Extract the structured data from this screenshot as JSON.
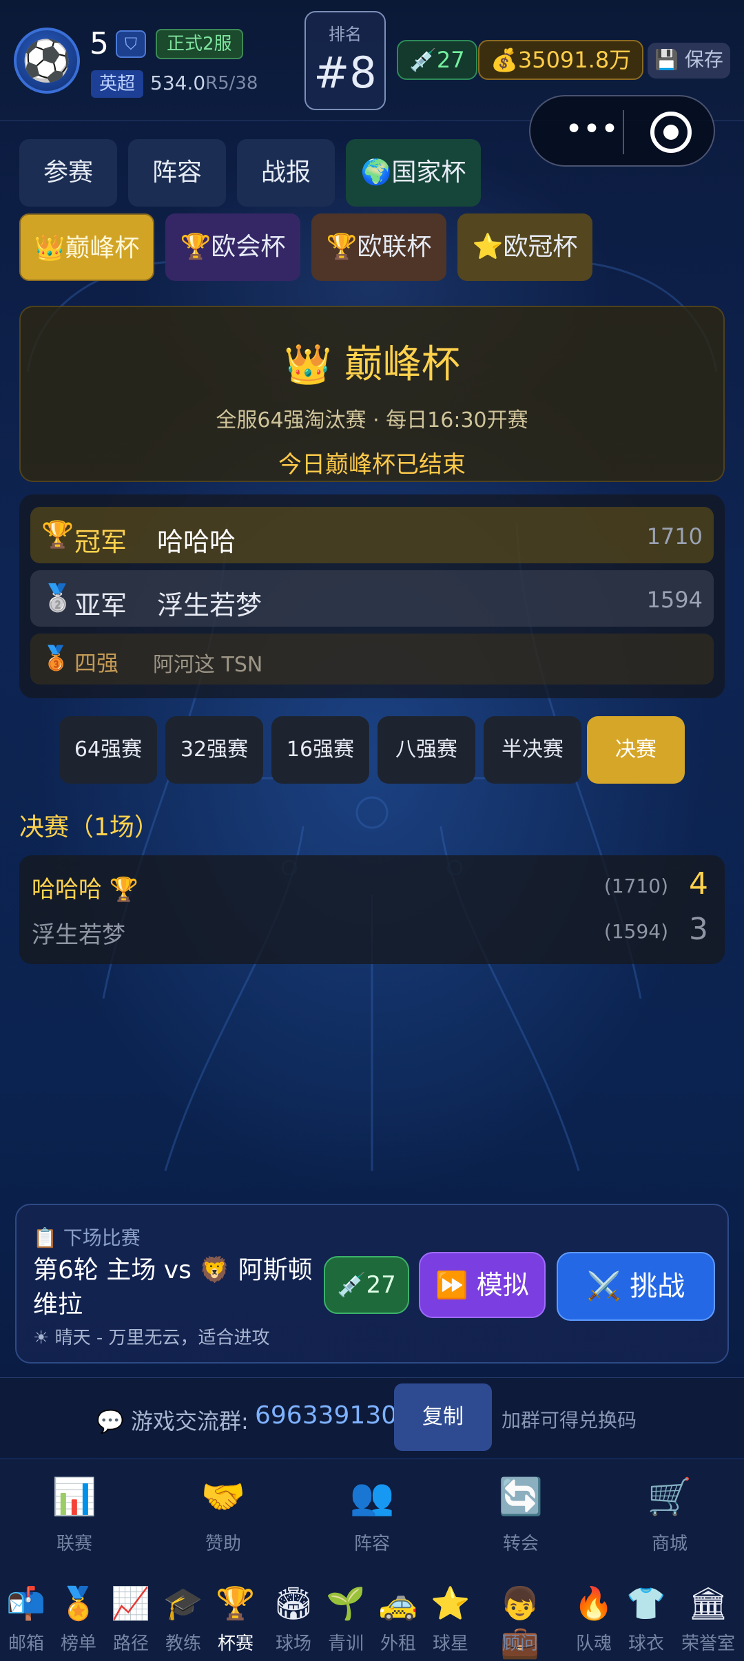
{
  "topbar": {
    "level": "5",
    "server": "正式2服",
    "league": "英超",
    "points": "534.0",
    "round": "R5/38",
    "rank_label": "排名",
    "rank_value": "#8",
    "energy": "27",
    "gold": "35091.8万",
    "save_label": "保存"
  },
  "capsule": {
    "menu": "•••"
  },
  "tabs_row1": [
    {
      "label": "参赛"
    },
    {
      "label": "阵容"
    },
    {
      "label": "战报"
    },
    {
      "label": "🌍国家杯"
    }
  ],
  "tabs_row2": [
    {
      "label": "👑巅峰杯"
    },
    {
      "label": "🏆欧会杯"
    },
    {
      "label": "🏆欧联杯"
    },
    {
      "label": "⭐欧冠杯"
    }
  ],
  "hero": {
    "title": "👑 巅峰杯",
    "subtitle": "全服64强淘汰赛 · 每日16:30开赛",
    "status": "今日巅峰杯已结束"
  },
  "results": {
    "champion": {
      "icon": "🏆",
      "rank": "冠军",
      "name": "哈哈哈",
      "score": "1710"
    },
    "runner_up": {
      "icon": "🥈",
      "rank": "亚军",
      "name": "浮生若梦",
      "score": "1594"
    },
    "semis": {
      "icon": "🥉",
      "rank": "四强",
      "names": "阿河这  TSN"
    }
  },
  "stages": [
    "64强赛",
    "32强赛",
    "16强赛",
    "八强赛",
    "半决赛",
    "决赛"
  ],
  "section_title": "决赛（1场）",
  "match": {
    "team1": "哈哈哈 🏆",
    "team1_rating": "(1710)",
    "team1_goals": "4",
    "team2": "浮生若梦",
    "team2_rating": "(1594)",
    "team2_goals": "3"
  },
  "next_match": {
    "label": "📋 下场比赛",
    "description": "第6轮 主场 vs 🦁 阿斯顿维拉",
    "weather": "☀ 晴天 - 万里无云，适合进攻",
    "energy_btn": "27",
    "simulate_btn": "⏩ 模拟",
    "challenge_btn": "⚔️ 挑战"
  },
  "group": {
    "text": "💬 游戏交流群:",
    "number": "696339130",
    "copy_btn": "复制",
    "tip": "加群可得兑换码"
  },
  "nav_main": [
    {
      "icon": "📊",
      "label": "联赛"
    },
    {
      "icon": "🤝",
      "label": "赞助"
    },
    {
      "icon": "👥",
      "label": "阵容"
    },
    {
      "icon": "🔄",
      "label": "转会"
    },
    {
      "icon": "🛒",
      "label": "商城"
    }
  ],
  "nav_sub": [
    {
      "icon": "📬",
      "label": "邮箱"
    },
    {
      "icon": "🏅",
      "label": "榜单"
    },
    {
      "icon": "📈",
      "label": "路径"
    },
    {
      "icon": "🎓",
      "label": "教练"
    },
    {
      "icon": "🏆",
      "label": "杯赛"
    },
    {
      "icon": "🏟",
      "label": "球场"
    },
    {
      "icon": "🌱",
      "label": "青训"
    },
    {
      "icon": "🚕",
      "label": "外租"
    },
    {
      "icon": "⭐",
      "label": "球星"
    },
    {
      "icon": "👦💼",
      "label": "顾问"
    },
    {
      "icon": "🔥",
      "label": "队魂"
    },
    {
      "icon": "👕",
      "label": "球衣"
    },
    {
      "icon": "🏛",
      "label": "荣誉室"
    }
  ]
}
